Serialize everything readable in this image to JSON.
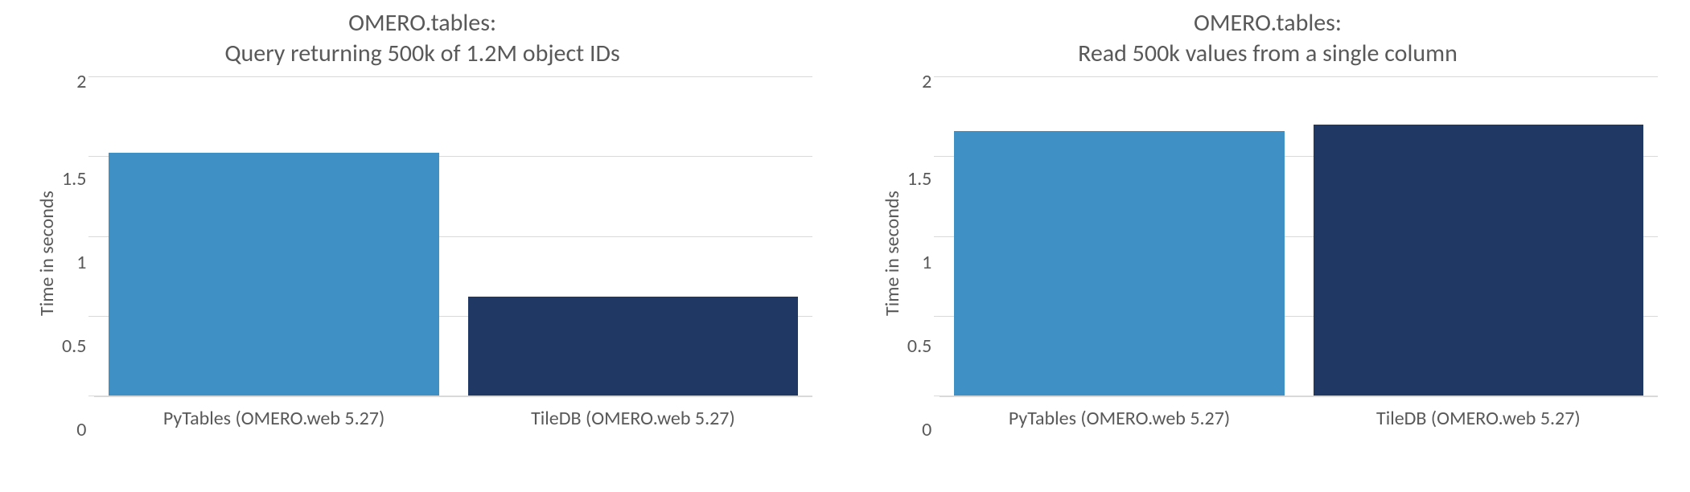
{
  "chart_data": [
    {
      "type": "bar",
      "title_line1": "OMERO.tables:",
      "title_line2": "Query returning 500k of 1.2M object IDs",
      "ylabel": "Time in seconds",
      "xlabel": "",
      "ylim": [
        0,
        2
      ],
      "yticks": [
        "2",
        "1.5",
        "1",
        "0.5",
        "0"
      ],
      "categories": [
        "PyTables (OMERO.web 5.27)",
        "TileDB (OMERO.web 5.27)"
      ],
      "values": [
        1.52,
        0.62
      ],
      "colors": [
        "#3f90c5",
        "#1f3864"
      ]
    },
    {
      "type": "bar",
      "title_line1": "OMERO.tables:",
      "title_line2": "Read 500k values from a single column",
      "ylabel": "Time in seconds",
      "xlabel": "",
      "ylim": [
        0,
        2
      ],
      "yticks": [
        "2",
        "1.5",
        "1",
        "0.5",
        "0"
      ],
      "categories": [
        "PyTables (OMERO.web 5.27)",
        "TileDB (OMERO.web 5.27)"
      ],
      "values": [
        1.66,
        1.7
      ],
      "colors": [
        "#3f90c5",
        "#1f3864"
      ]
    }
  ]
}
